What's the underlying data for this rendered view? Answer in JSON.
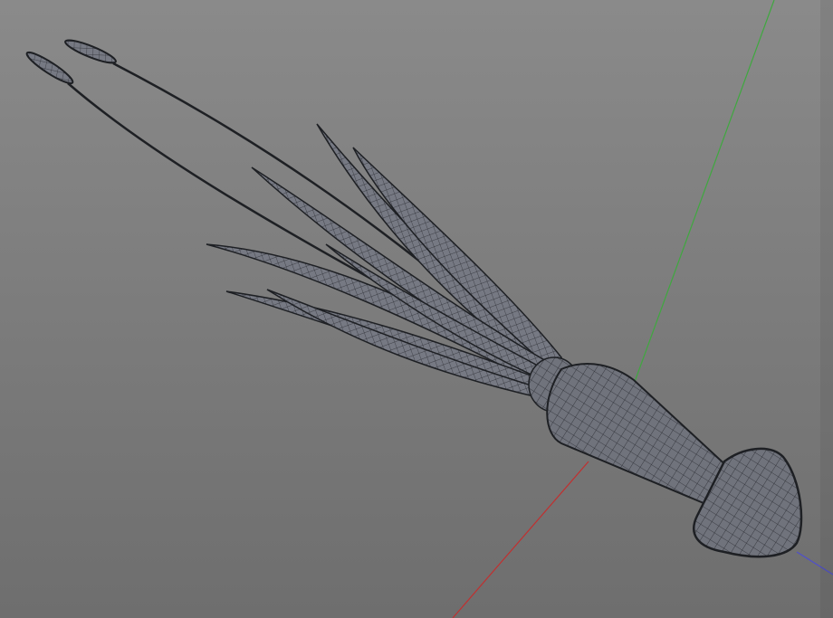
{
  "viewport": {
    "background_top": "#8a8a8a",
    "background_bottom": "#6e6e6e",
    "axes": {
      "x_axis_color": "#c03030",
      "y_axis_color": "#3fa83f",
      "z_axis_color": "#5050c8"
    },
    "model": {
      "icon": "squid-mesh",
      "mesh_fill": "#6f727b",
      "wire_color": "#2a2c32"
    }
  }
}
